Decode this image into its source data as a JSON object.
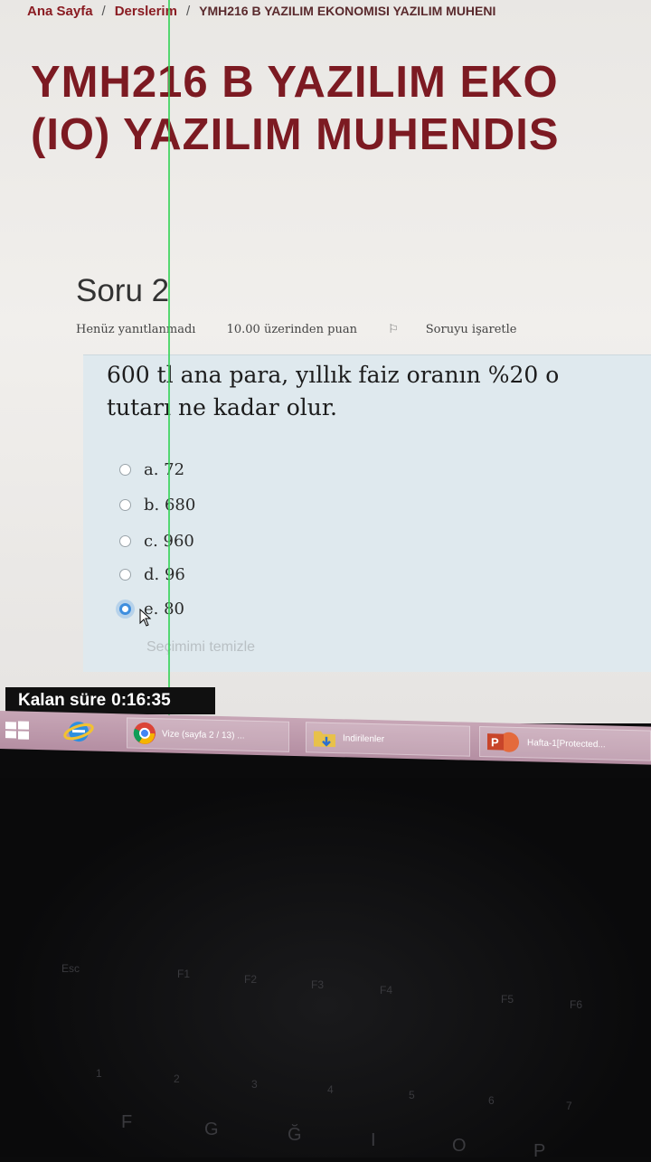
{
  "breadcrumb": {
    "home": "Ana Sayfa",
    "courses": "Derslerim",
    "current": "YMH216 B YAZILIM EKONOMISI YAZILIM MUHENI"
  },
  "course_title": {
    "line1": "YMH216 B YAZILIM EKO",
    "line2": "(IO) YAZILIM MUHENDIS"
  },
  "question": {
    "heading": "Soru 2",
    "status": "Henüz yanıtlanmadı",
    "points": "10.00 üzerinden puan",
    "flag_label": "Soruyu işaretle",
    "text_line1": "600 tl ana para, yıllık faiz oranın %20 o",
    "text_line2": "tutarı ne kadar olur.",
    "options": [
      {
        "label": "a. 72",
        "selected": false
      },
      {
        "label": "b. 680",
        "selected": false
      },
      {
        "label": "c. 960",
        "selected": false
      },
      {
        "label": "d. 96",
        "selected": false
      },
      {
        "label": "e. 80",
        "selected": true
      }
    ],
    "clear_choice": "Seçimimi temizle"
  },
  "timer": {
    "label": "Kalan süre",
    "value": "0:16:35"
  },
  "taskbar": {
    "chrome_window": "Vize (sayfa 2 / 13) ...",
    "folder_window": "İndirilenler",
    "ppt_window": "Hafta-1[Protected..."
  },
  "colors": {
    "brand": "#7c1a22",
    "question_bg": "#dfe9ee",
    "radio_selected": "#3e8ede",
    "taskbar": "#b48ea2"
  }
}
